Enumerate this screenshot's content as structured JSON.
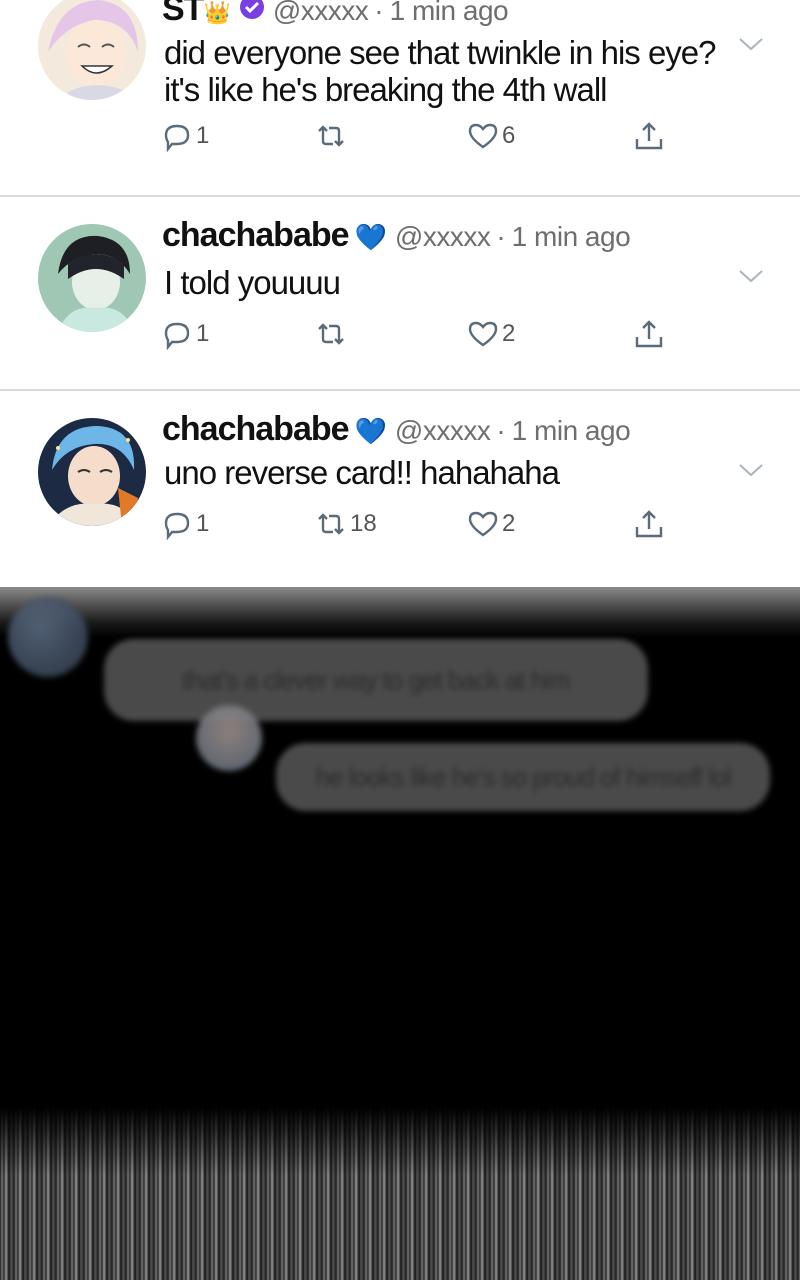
{
  "tweets": [
    {
      "name": "ST",
      "name_suffix": "👑",
      "badge": "✔",
      "handle": "@xxxxx",
      "time": "1 min ago",
      "text_line1": "did everyone see that twinkle in his eye?",
      "text_line2": "it's like he's breaking the 4th wall",
      "replies": "1",
      "retweets": "",
      "likes": "6"
    },
    {
      "name": "chachababe",
      "badge": "💙",
      "handle": "@xxxxx",
      "time": "1 min ago",
      "text": "I told youuuu",
      "replies": "1",
      "retweets": "",
      "likes": "2"
    },
    {
      "name": "chachababe",
      "badge": "💙",
      "handle": "@xxxxx",
      "time": "1 min ago",
      "text": "uno reverse card!! hahahaha",
      "replies": "1",
      "retweets": "18",
      "likes": "2"
    }
  ],
  "chat": {
    "messages": [
      "that's a clever way to get back at him",
      "he looks like he's so proud of himself lol"
    ]
  },
  "colors": {
    "heart_outline": "#5a6b7a",
    "verified_purple": "#7a3fe0",
    "crown": "#f2b830"
  },
  "icons": [
    "reply-icon",
    "retweet-icon",
    "like-icon",
    "share-icon",
    "chevron-down-icon"
  ]
}
